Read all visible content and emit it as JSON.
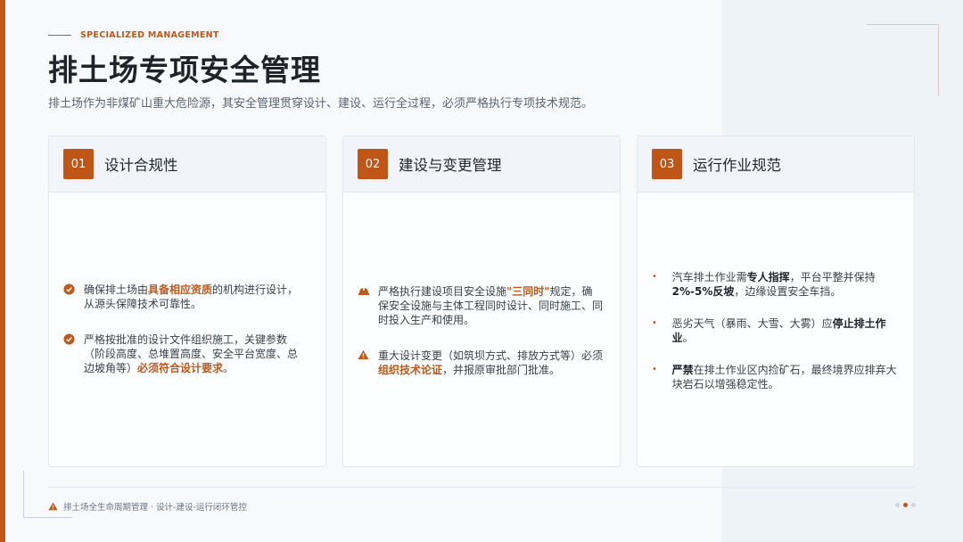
{
  "header": {
    "kicker": "SPECIALIZED MANAGEMENT",
    "title": "排土场专项安全管理",
    "subtitle": "排土场作为非煤矿山重大危险源，其安全管理贯穿设计、建设、运行全过程，必须严格执行专项技术规范。"
  },
  "colors": {
    "accent": "#c0581a",
    "text": "#3a3f47",
    "title": "#1f2329"
  },
  "cards": [
    {
      "num": "01",
      "title": "设计合规性",
      "items": [
        {
          "icon": "check-circle-icon",
          "pre": "确保排土场由",
          "hl": "具备相应资质",
          "post": "的机构进行设计，从源头保障技术可靠性。"
        },
        {
          "icon": "check-circle-icon",
          "pre": "严格按批准的设计文件组织施工，关键参数（阶段高度、总堆置高度、安全平台宽度、总边坡角等）",
          "hl": "必须符合设计要求",
          "post": "。"
        }
      ]
    },
    {
      "num": "02",
      "title": "建设与变更管理",
      "items": [
        {
          "icon": "hard-hat-icon",
          "pre": "严格执行建设项目安全设施",
          "hl": "\"三同时\"",
          "post": "规定，确保安全设施与主体工程同时设计、同时施工、同时投入生产和使用。"
        },
        {
          "icon": "warning-icon",
          "pre": "重大设计变更（如筑坝方式、排放方式等）必须",
          "hl": "组织技术论证",
          "post": "，并报原审批部门批准。"
        }
      ]
    },
    {
      "num": "03",
      "title": "运行作业规范",
      "items": [
        {
          "icon": "bullet-icon",
          "pre": "汽车排土作业需",
          "b1": "专人指挥",
          "mid": "，平台平整并保持",
          "b2": "2%-5%反坡",
          "post": "，边缘设置安全车挡。"
        },
        {
          "icon": "bullet-icon",
          "pre": "恶劣天气（暴雨、大雪、大雾）应",
          "b1": "停止排土作业",
          "post": "。"
        },
        {
          "icon": "bullet-icon",
          "b1": "严禁",
          "pre": "在排土作业区内捡矿石，最终境界应排弃大块岩石以增强稳定性。"
        }
      ]
    }
  ],
  "footer": {
    "icon": "warning-icon",
    "text": "排土场全生命周期管理 · 设计-建设-运行闭环管控"
  },
  "pager": {
    "total": 3,
    "active": 2
  }
}
